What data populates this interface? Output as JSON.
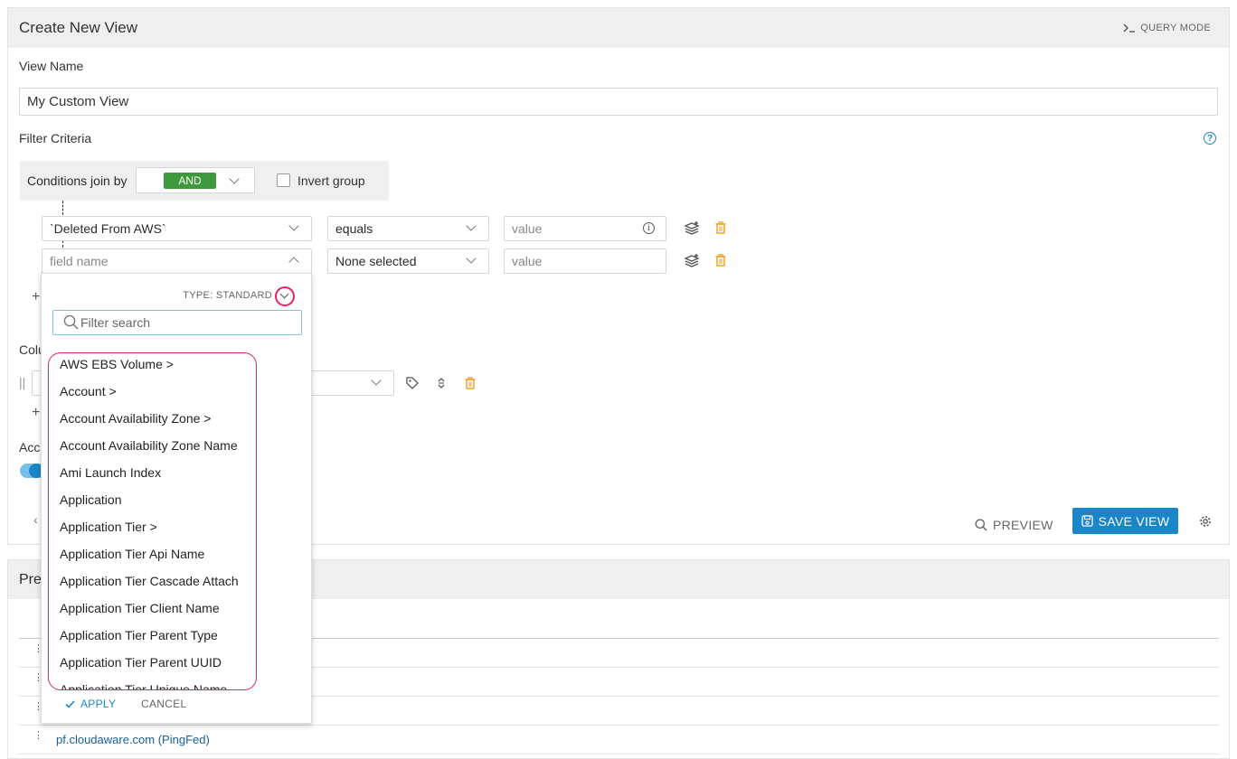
{
  "header": {
    "title": "Create New View",
    "query_mode_label": "QUERY MODE"
  },
  "view_name": {
    "label": "View Name",
    "value": "My Custom View"
  },
  "filter": {
    "label": "Filter Criteria",
    "conditions_join_label": "Conditions join by",
    "join_value": "AND",
    "invert_label": "Invert group",
    "rows": [
      {
        "field": "`Deleted From AWS`",
        "operator": "equals",
        "value_placeholder": "value"
      },
      {
        "field_placeholder": "field name",
        "operator": "None selected",
        "value_placeholder": "value"
      }
    ]
  },
  "hidden_labels": {
    "columns_partial": "Colu",
    "access_partial": "Acc",
    "preview_partial": "Pre"
  },
  "actions": {
    "preview_label": "PREVIEW",
    "save_label": "SAVE VIEW"
  },
  "preview_rows": [
    {
      "text": ""
    },
    {
      "text": ""
    },
    {
      "text": ""
    },
    {
      "text": "pf.cloudaware.com (PingFed)"
    }
  ],
  "dropdown": {
    "type_label": "TYPE: STANDARD",
    "search_placeholder": "Filter search",
    "options": [
      "AWS EBS Volume >",
      "Account >",
      "Account Availability Zone >",
      "Account Availability Zone Name",
      "Ami Launch Index",
      "Application",
      "Application Tier >",
      "Application Tier Api Name",
      "Application Tier Cascade Attach",
      "Application Tier Client Name",
      "Application Tier Parent Type",
      "Application Tier Parent UUID",
      "Application Tier Unique Name"
    ],
    "apply_label": "APPLY",
    "cancel_label": "CANCEL"
  },
  "colors": {
    "accent": "#1a86c9",
    "and_green": "#3c9a3c",
    "trash_orange": "#f0a020",
    "highlight": "#e0246b"
  }
}
